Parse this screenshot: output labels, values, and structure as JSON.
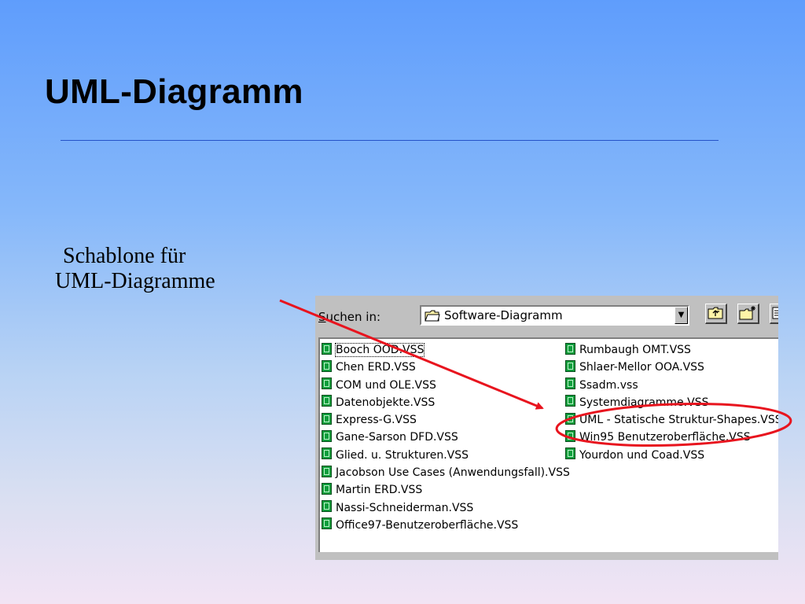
{
  "slide": {
    "title": "UML-Diagramm",
    "caption_line1": "Schablone für",
    "caption_line2": "UML-Diagramme"
  },
  "dialog": {
    "look_in_underlined": "S",
    "look_in_rest": "uchen in:",
    "folder": "Software-Diagramm",
    "combo_arrow": "▼",
    "toolbar_icons": [
      "up-one-level-icon",
      "create-new-folder-icon",
      "list-view-icon"
    ],
    "files_col1": [
      "Booch OOD.VSS",
      "Chen ERD.VSS",
      "COM und OLE.VSS",
      "Datenobjekte.VSS",
      "Express-G.VSS",
      "Gane-Sarson DFD.VSS",
      "Glied. u. Strukturen.VSS",
      "Jacobson Use Cases (Anwendungsfall).VSS",
      "Martin ERD.VSS",
      "Nassi-Schneiderman.VSS",
      "Office97-Benutzeroberfläche.VSS"
    ],
    "files_col2": [
      "Rumbaugh OMT.VSS",
      "Shlaer-Mellor OOA.VSS",
      "Ssadm.vss",
      "Systemdiagramme.VSS",
      "UML - Statische Struktur-Shapes.VSS",
      "Win95 Benutzeroberfläche.VSS",
      "Yourdon und Coad.VSS"
    ]
  },
  "annotation": {
    "color": "#e8141e"
  }
}
